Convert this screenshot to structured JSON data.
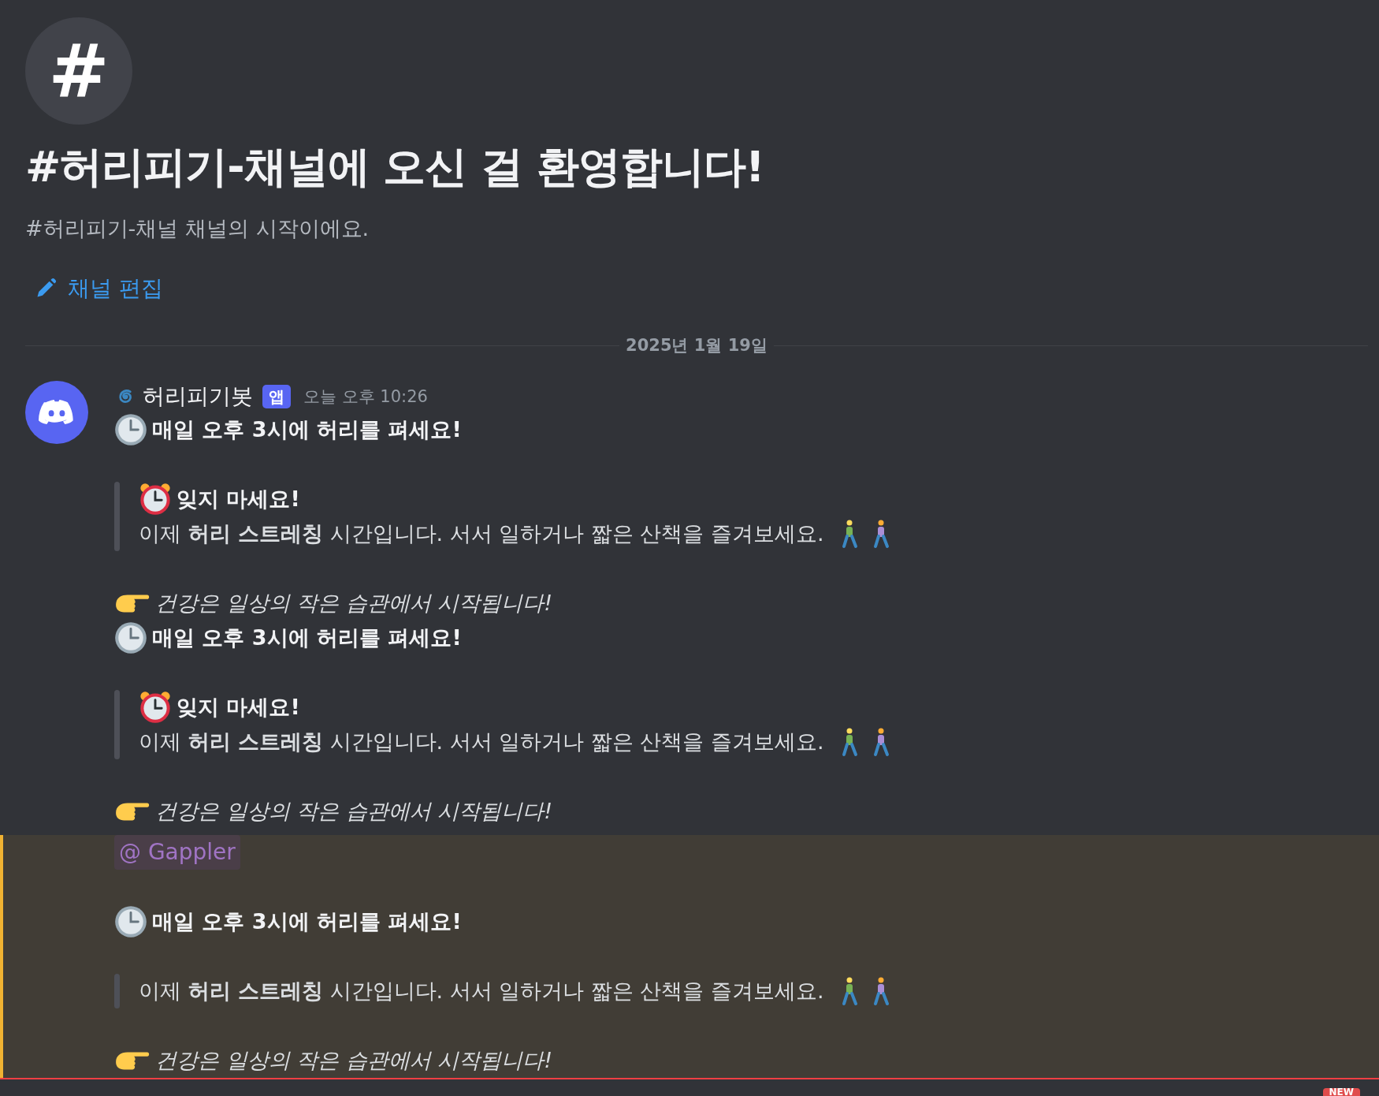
{
  "channel_icon": "#",
  "title": "#허리피기-채널에 오신 걸 환영합니다!",
  "subtitle": "#허리피기-채널 채널의 시작이에요.",
  "edit_link": "채널 편집",
  "date_divider": "2025년 1월 19일",
  "message": {
    "author": "허리피기봇",
    "badge": "앱",
    "timestamp": "오늘 오후 10:26"
  },
  "blocks": [
    {
      "mentioned": false,
      "heading": "매일 오후 3시에 허리를 펴세요!",
      "quote_title": "잊지 마세요!",
      "quote_text": "이제 **허리 스트레칭** 시간입니다. 서서 일하거나 짧은 산책을 즐겨보세요.",
      "footer": "건강은 일상의 작은 습관에서 시작됩니다!"
    },
    {
      "mentioned": false,
      "heading": "매일 오후 3시에 허리를 펴세요!",
      "quote_title": "잊지 마세요!",
      "quote_text": "이제 **허리 스트레칭** 시간입니다. 서서 일하거나 짧은 산책을 즐겨보세요.",
      "footer": "건강은 일상의 작은 습관에서 시작됩니다!"
    },
    {
      "mentioned": true,
      "mention": "@ Gappler",
      "heading": "매일 오후 3시에 허리를 펴세요!",
      "quote_text": "이제 **허리 스트레칭** 시간입니다. 서서 일하거나 짧은 산책을 즐겨보세요.",
      "footer": "건강은 일상의 작은 습관에서 시작됩니다!"
    }
  ],
  "new_badge": "NEW"
}
